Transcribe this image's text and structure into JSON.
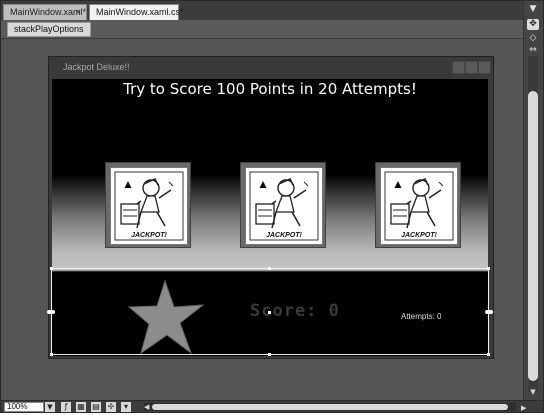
{
  "tabs": [
    {
      "label": "MainWindow.xaml*",
      "close": "×"
    },
    {
      "label": "MainWindow.xaml.cs*"
    }
  ],
  "breadcrumb": {
    "item": "stackPlayOptions"
  },
  "window": {
    "title": "Jackpot Deluxe!!"
  },
  "game": {
    "headline": "Try to Score 100 Points in 20 Attempts!",
    "reels": [
      {
        "caption": "JACKPOT!"
      },
      {
        "caption": "JACKPOT!"
      },
      {
        "caption": "JACKPOT!"
      }
    ],
    "score_text": "Score: 0",
    "attempts_text": "Attempts: 0"
  },
  "statusbar": {
    "zoom": "100%"
  },
  "colors": {
    "ide_background": "#4a4a4a",
    "client_top": "#000000",
    "gradient_band": "#c4c4c4",
    "star_fill": "#8c8c8c"
  },
  "icons": {
    "tab_close": "close-icon",
    "zoom_dropdown": "chevron-down-icon",
    "pan_tool": "hand-icon",
    "grid_toggle": "grid-icon",
    "split_view": "split-view-icon",
    "snap_toggle": "snap-icon",
    "annotation": "comment-icon"
  }
}
